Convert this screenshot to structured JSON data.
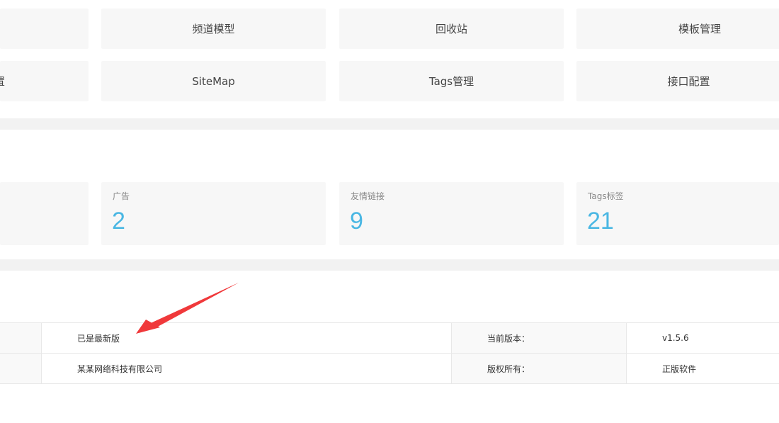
{
  "shortcuts": {
    "row1": [
      "",
      "频道模型",
      "回收站",
      "模板管理"
    ],
    "row2": [
      "置",
      "SiteMap",
      "Tags管理",
      "接口配置"
    ]
  },
  "stats": [
    {
      "label": "广告",
      "value": "2"
    },
    {
      "label": "友情链接",
      "value": "9"
    },
    {
      "label": "Tags标签",
      "value": "21"
    }
  ],
  "info": {
    "rows": [
      {
        "value": "已是最新版",
        "label": "当前版本：",
        "label_value": "v1.5.6"
      },
      {
        "value": "某某网络科技有限公司",
        "label": "版权所有：",
        "label_value": "正版软件"
      }
    ]
  },
  "colors": {
    "accent_number": "#4ab7e3",
    "arrow": "#f0393b",
    "tile_bg": "#f7f7f7"
  }
}
